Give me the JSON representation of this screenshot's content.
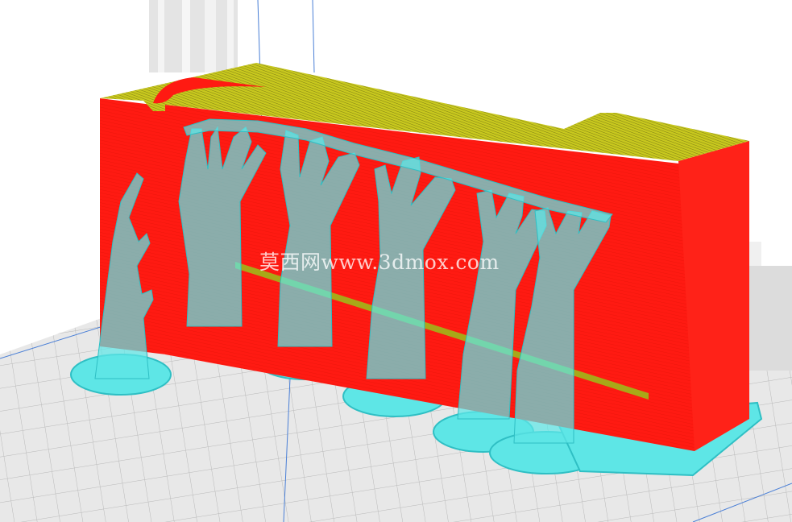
{
  "viewport": {
    "view": "layer-view-3d",
    "colors": {
      "background": "#ffffff",
      "build_plate": "#e6e6e6",
      "grid_line": "#b9b9b9",
      "model_wall": "#ff1a12",
      "top_infill": "#c8c81e",
      "support": "#5ee6e6",
      "support_outline": "#2fbfc4",
      "axis_line": "#4a7fd6"
    },
    "watermark": "莫西网www.3dmox.com"
  }
}
